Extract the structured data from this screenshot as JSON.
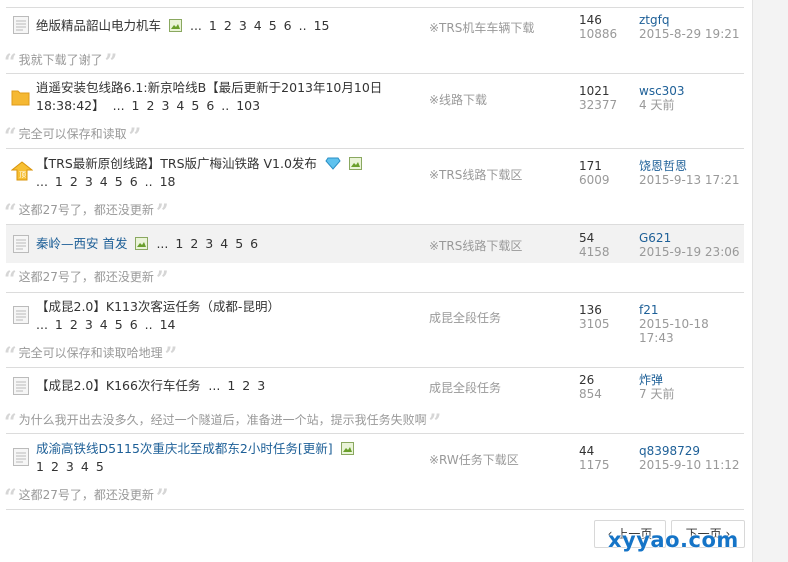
{
  "threads": [
    {
      "title": "绝版精品韶山电力机车",
      "pages": [
        "...",
        "1",
        "2",
        "3",
        "4",
        "5",
        "6",
        "..",
        "15"
      ],
      "forum": "※TRS机车车辆下载",
      "replies": "146",
      "views": "10886",
      "last_user": "ztgfq",
      "last_time": "2015-8-29 19:21",
      "quote": "我就下载了谢了"
    },
    {
      "title_line1": "逍遥安装包线路6.1:新京哈线B【最后更新于2013年10月10日",
      "title_line2": "18:38:42】",
      "pages": [
        "...",
        "1",
        "2",
        "3",
        "4",
        "5",
        "6",
        "..",
        "103"
      ],
      "forum": "※线路下载",
      "replies": "1021",
      "views": "32377",
      "last_user": "wsc303",
      "last_time": "4 天前",
      "quote": "完全可以保存和读取"
    },
    {
      "title": "【TRS最新原创线路】TRS版广梅汕铁路 V1.0发布",
      "pages": [
        "...",
        "1",
        "2",
        "3",
        "4",
        "5",
        "6",
        "..",
        "18"
      ],
      "forum": "※TRS线路下载区",
      "replies": "171",
      "views": "6009",
      "last_user": "饶恩哲恩",
      "last_time": "2015-9-13 17:21",
      "quote": "这都27号了，都还没更新"
    },
    {
      "title": "秦岭—西安 首发",
      "pages": [
        "...",
        "1",
        "2",
        "3",
        "4",
        "5",
        "6"
      ],
      "forum": "※TRS线路下载区",
      "replies": "54",
      "views": "4158",
      "last_user": "G621",
      "last_time": "2015-9-19 23:06",
      "quote": "这都27号了，都还没更新"
    },
    {
      "title": "【成昆2.0】K113次客运任务（成都-昆明）",
      "pages": [
        "...",
        "1",
        "2",
        "3",
        "4",
        "5",
        "6",
        "..",
        "14"
      ],
      "forum": "成昆全段任务",
      "replies": "136",
      "views": "3105",
      "last_user": "f21",
      "last_time": "2015-10-18 17:43",
      "quote": "完全可以保存和读取哈地理"
    },
    {
      "title": "【成昆2.0】K166次行车任务",
      "pages": [
        "...",
        "1",
        "2",
        "3"
      ],
      "forum": "成昆全段任务",
      "replies": "26",
      "views": "854",
      "last_user": "炸弹",
      "last_time": "7 天前",
      "quote": "为什么我开出去没多久，经过一个隧道后，准备进一个站，提示我任务失败啊"
    },
    {
      "title": "成渝高铁线D5115次重庆北至成都东2小时任务[更新]",
      "pages": [
        "1",
        "2",
        "3",
        "4",
        "5"
      ],
      "forum": "※RW任务下载区",
      "replies": "44",
      "views": "1175",
      "last_user": "q8398729",
      "last_time": "2015-9-10 11:12",
      "quote": "这都27号了，都还没更新"
    }
  ],
  "pager": {
    "prev": "上一页",
    "next": "下一页"
  },
  "watermark": "xyyao.com",
  "colors": {
    "link": "#1d5f97",
    "muted": "#999999",
    "highlight_row": "#f2f2f2"
  }
}
